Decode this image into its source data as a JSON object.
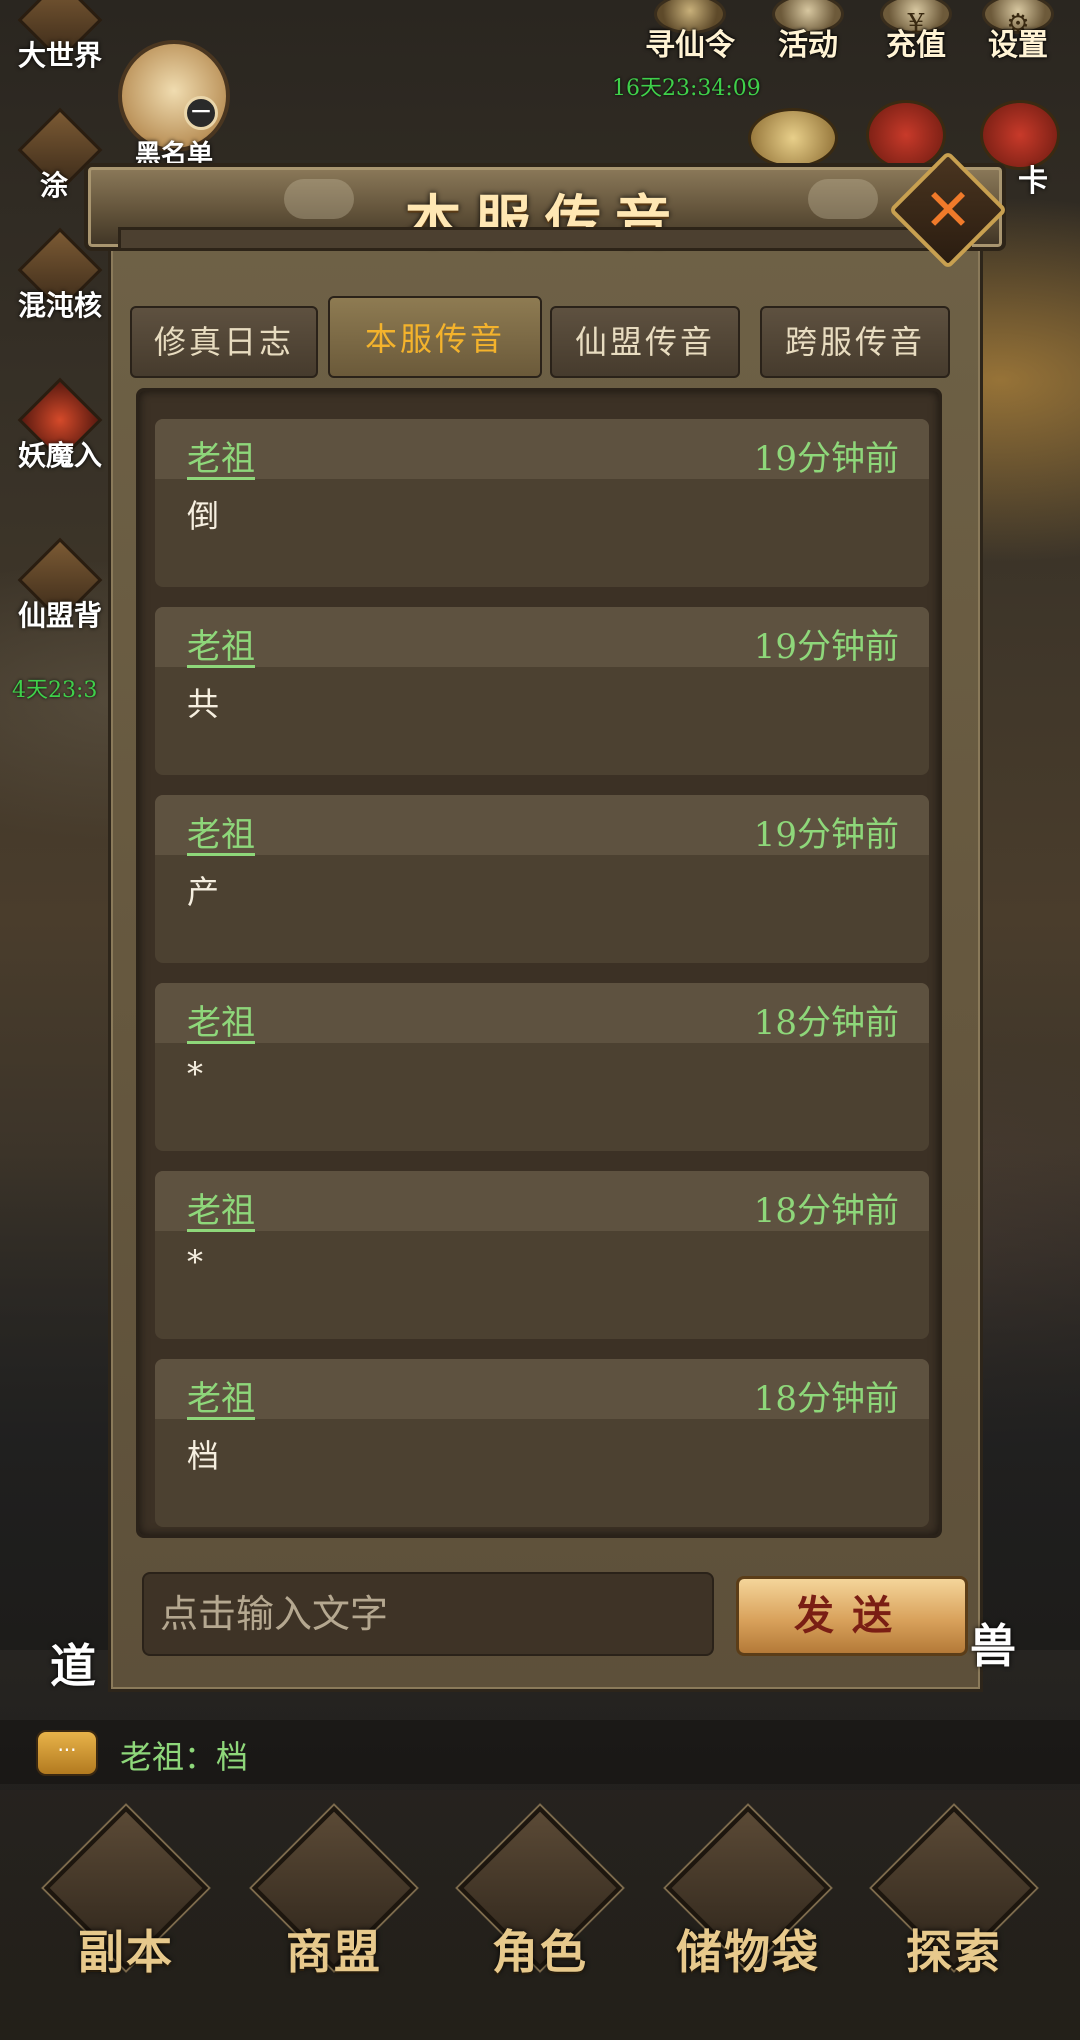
{
  "hud": {
    "top_icons": [
      {
        "label": "寻仙令",
        "icon": "token-icon"
      },
      {
        "label": "活动",
        "icon": "smiley-icon"
      },
      {
        "label": "充值",
        "icon": "coin-icon"
      },
      {
        "label": "设置",
        "icon": "gear-icon"
      }
    ],
    "top_timer": "16天23:34:09",
    "left_icons": [
      {
        "label": "大世界",
        "icon": "world-icon"
      },
      {
        "label": "涂",
        "icon": "gourd-icon"
      },
      {
        "label": "混沌核",
        "icon": "scroll-icon"
      },
      {
        "label": "妖魔入",
        "icon": "demon-icon"
      },
      {
        "label": "仙盟背",
        "icon": "alliance-icon"
      }
    ],
    "left_timer": "4天23:3",
    "blacklist_label": "黑名单",
    "right_card_label": "卡",
    "side_left_label": "道",
    "side_right_label": "兽"
  },
  "dialog": {
    "title": "本服传音",
    "tabs": [
      {
        "label": "修真日志",
        "active": false
      },
      {
        "label": "本服传音",
        "active": true
      },
      {
        "label": "仙盟传音",
        "active": false
      },
      {
        "label": "跨服传音",
        "active": false
      }
    ],
    "messages": [
      {
        "sender": "老祖",
        "time": "19分钟前",
        "content": "倒"
      },
      {
        "sender": "老祖",
        "time": "19分钟前",
        "content": "共"
      },
      {
        "sender": "老祖",
        "time": "19分钟前",
        "content": "产"
      },
      {
        "sender": "老祖",
        "time": "18分钟前",
        "content": "*"
      },
      {
        "sender": "老祖",
        "time": "18分钟前",
        "content": "*"
      },
      {
        "sender": "老祖",
        "time": "18分钟前",
        "content": "档"
      }
    ],
    "input_placeholder": "点击输入文字",
    "send_label": "发送"
  },
  "chat_bar": {
    "bubble": "···",
    "text": "老祖：档"
  },
  "bottom_nav": [
    {
      "label": "副本",
      "icon": "map-icon"
    },
    {
      "label": "商盟",
      "icon": "shop-icon"
    },
    {
      "label": "角色",
      "icon": "helmet-icon"
    },
    {
      "label": "储物袋",
      "icon": "bag-icon"
    },
    {
      "label": "探索",
      "icon": "compass-icon"
    }
  ],
  "colors": {
    "accent_green": "#8ed77a",
    "tab_active": "#f4b32c",
    "title": "#ffe7b3"
  }
}
